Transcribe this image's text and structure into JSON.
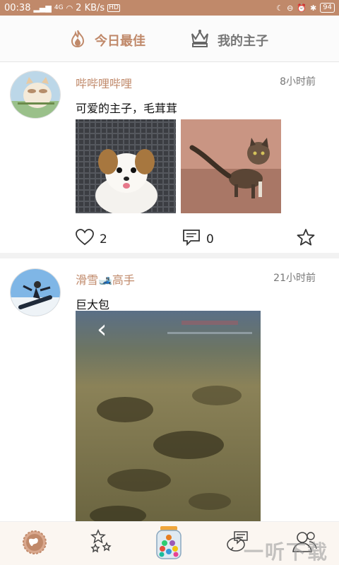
{
  "status_bar": {
    "time": "00:38",
    "network": "4G",
    "speed": "2 KB/s",
    "hd_badge": "HD",
    "battery": "94"
  },
  "header": {
    "tabs": [
      {
        "label": "今日最佳",
        "active": true,
        "icon": "flame-icon"
      },
      {
        "label": "我的主子",
        "active": false,
        "icon": "crown-icon"
      }
    ]
  },
  "posts": [
    {
      "username": "哔哔哩哔哩",
      "time": "8小时前",
      "text": "可爱的主子，毛茸茸",
      "likes": "2",
      "comments": "0"
    },
    {
      "username": "滑雪🎿高手",
      "time": "21小时前",
      "text": "巨大包",
      "prev_arrow": "‹"
    }
  ],
  "bottom_nav": {
    "items": [
      "globe-icon",
      "stars-icon",
      "candy-jar-icon",
      "chat-icon",
      "friends-icon"
    ]
  },
  "watermark": "一听下载",
  "colors": {
    "accent": "#c0896a",
    "status_bar": "#c0896a"
  }
}
